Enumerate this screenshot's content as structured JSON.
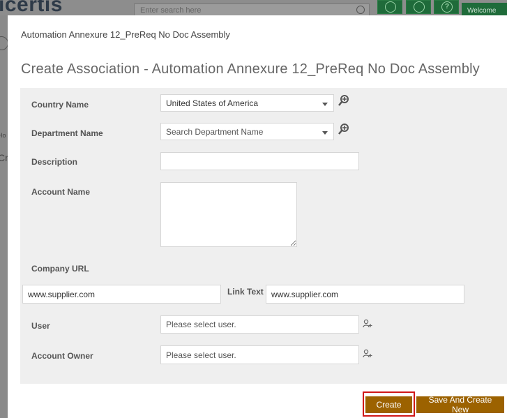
{
  "background": {
    "logo": "icertis",
    "search_placeholder": "Enter search here",
    "welcome": "Welcome",
    "left_label_1": "Ho",
    "left_label_2": "Cr"
  },
  "modal": {
    "window_title": "Automation Annexure 12_PreReq No Doc Assembly",
    "close_glyph": "×",
    "heading": "Create Association - Automation Annexure 12_PreReq No Doc Assembly"
  },
  "form": {
    "country_name": {
      "label": "Country Name",
      "value": "United States of America"
    },
    "department_name": {
      "label": "Department Name",
      "placeholder": "Search Department Name"
    },
    "description": {
      "label": "Description",
      "value": ""
    },
    "account_name": {
      "label": "Account Name",
      "value": ""
    },
    "company_url": {
      "label": "Company URL",
      "value": "www.supplier.com"
    },
    "link_text": {
      "label": "Link Text",
      "value": "www.supplier.com"
    },
    "user": {
      "label": "User",
      "placeholder": "Please select user."
    },
    "account_owner": {
      "label": "Account Owner",
      "placeholder": "Please select user."
    }
  },
  "buttons": {
    "create": "Create",
    "save_and_create_new": "Save And Create New"
  },
  "icons": {
    "lookup": "lookup-add-icon",
    "user_picker": "user-picker-icon",
    "dropdown": "chevron-down-icon"
  },
  "colors": {
    "primary_button": "#9c6200",
    "highlight_border": "#d01818",
    "form_panel": "#efefef",
    "header_accent": "#1f6b3a"
  }
}
